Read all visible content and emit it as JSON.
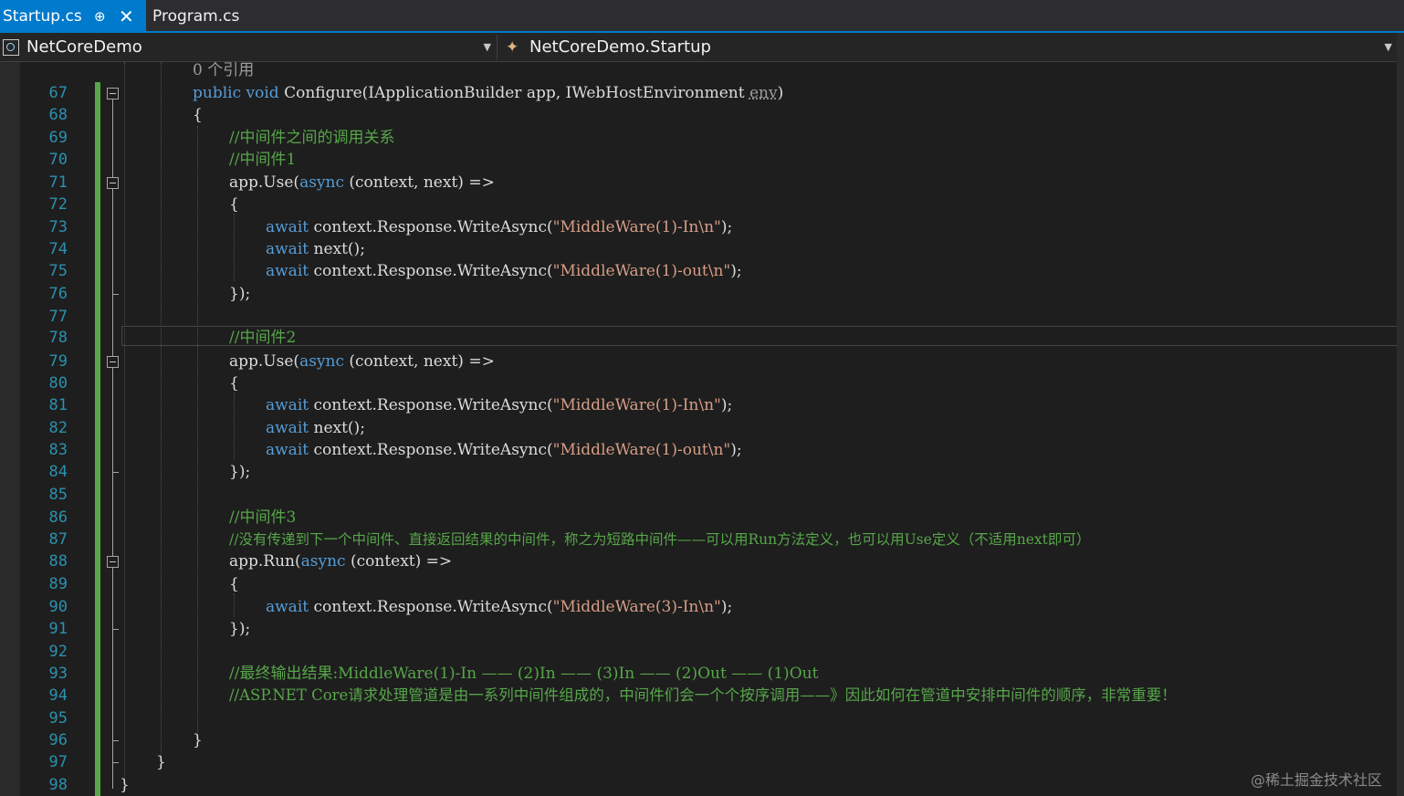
{
  "tabs": [
    {
      "label": "Startup.cs",
      "active": true,
      "pin_icon": "pin-icon",
      "close_icon": "close-icon"
    },
    {
      "label": "Program.cs",
      "active": false
    }
  ],
  "navbar": {
    "project": {
      "icon": "csharp-project-icon",
      "label": "NetCoreDemo"
    },
    "class": {
      "icon": "class-icon",
      "label": "NetCoreDemo.Startup"
    }
  },
  "editor": {
    "reference_count": "0 个引用",
    "line_numbers": [
      "67",
      "68",
      "69",
      "70",
      "71",
      "72",
      "73",
      "74",
      "75",
      "76",
      "77",
      "78",
      "79",
      "80",
      "81",
      "82",
      "83",
      "84",
      "85",
      "86",
      "87",
      "88",
      "89",
      "90",
      "91",
      "92",
      "93",
      "94",
      "95",
      "96",
      "97",
      "98"
    ],
    "lines": {
      "l67": {
        "kw1": "public",
        "kw2": "void",
        "name": "Configure",
        "p1": "(IApplicationBuilder app, ",
        "p2": "IWebHostEnvironment ",
        "p3": "env",
        "p4": ")"
      },
      "l68": "{",
      "l69": "//中间件之间的调用关系",
      "l70": "//中间件1",
      "l71": {
        "pre": "app.Use(",
        "kw": "async",
        "post": " (context, next) =>"
      },
      "l72": "{",
      "l73": {
        "kw": "await",
        "pre": " context.Response.WriteAsync(",
        "str": "\"MiddleWare(1)-In\\n\"",
        "post": ");"
      },
      "l74": {
        "kw": "await",
        "rest": " next();"
      },
      "l75": {
        "kw": "await",
        "pre": " context.Response.WriteAsync(",
        "str": "\"MiddleWare(1)-out\\n\"",
        "post": ");"
      },
      "l76": "});",
      "l78": "//中间件2",
      "l79": {
        "pre": "app.Use(",
        "kw": "async",
        "post": " (context, next) =>"
      },
      "l80": "{",
      "l81": {
        "kw": "await",
        "pre": " context.Response.WriteAsync(",
        "str": "\"MiddleWare(1)-In\\n\"",
        "post": ");"
      },
      "l82": {
        "kw": "await",
        "rest": " next();"
      },
      "l83": {
        "kw": "await",
        "pre": " context.Response.WriteAsync(",
        "str": "\"MiddleWare(1)-out\\n\"",
        "post": ");"
      },
      "l84": "});",
      "l86": "//中间件3",
      "l87": "//没有传递到下一个中间件、直接返回结果的中间件，称之为短路中间件——可以用Run方法定义，也可以用Use定义（不适用next即可）",
      "l88": {
        "pre": "app.Run(",
        "kw": "async",
        "post": " (context) =>"
      },
      "l89": "{",
      "l90": {
        "kw": "await",
        "pre": " context.Response.WriteAsync(",
        "str": "\"MiddleWare(3)-In\\n\"",
        "post": ");"
      },
      "l91": "});",
      "l93": "//最终输出结果:MiddleWare(1)-In —— (2)In —— (3)In —— (2)Out —— (1)Out",
      "l94": "//ASP.NET Core请求处理管道是由一系列中间件组成的，中间件们会一个个按序调用——》因此如何在管道中安排中间件的顺序，非常重要！",
      "l96": "}",
      "l97": "}",
      "l98": "}"
    }
  },
  "watermark": "@稀土掘金技术社区",
  "colors": {
    "background": "#1e1e1e",
    "keyword": "#569cd6",
    "string": "#d69d85",
    "comment": "#57a64a",
    "line_number": "#2b91af",
    "accent": "#007acc"
  }
}
